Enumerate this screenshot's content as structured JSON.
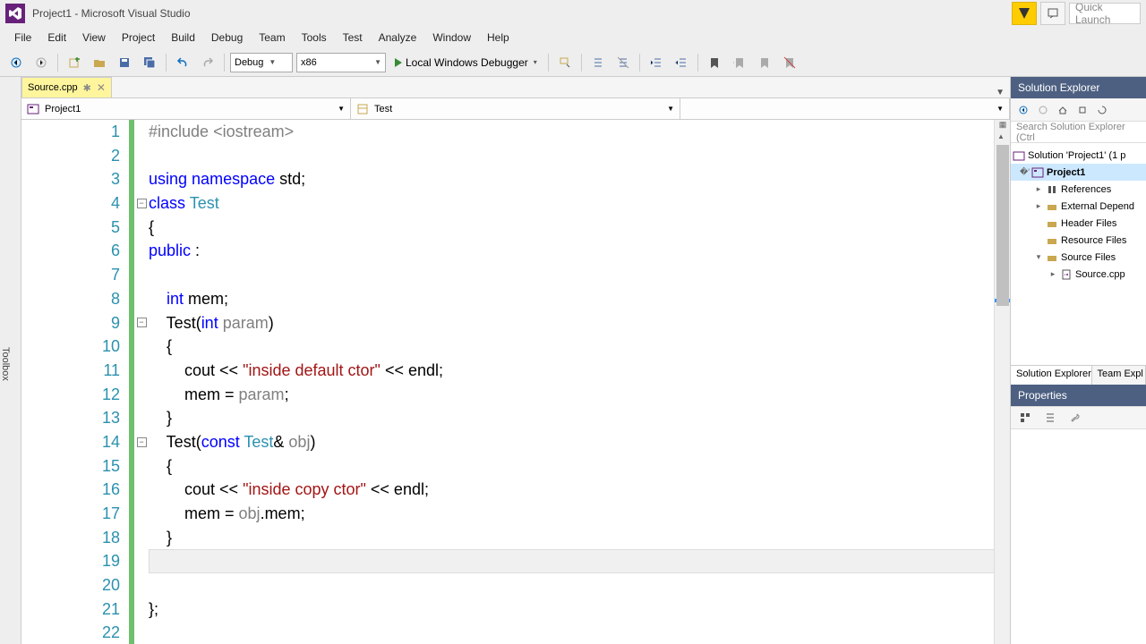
{
  "title": "Project1 - Microsoft Visual Studio",
  "quick_launch_placeholder": "Quick Launch",
  "menu": [
    "File",
    "Edit",
    "View",
    "Project",
    "Build",
    "Debug",
    "Team",
    "Tools",
    "Test",
    "Analyze",
    "Window",
    "Help"
  ],
  "toolbar": {
    "config": "Debug",
    "platform": "x86",
    "debugger": "Local Windows Debugger"
  },
  "toolbox_label": "Toolbox",
  "tab": {
    "name": "Source.cpp",
    "modified": "✱"
  },
  "context": {
    "project": "Project1",
    "scope": "Test"
  },
  "code": [
    {
      "n": 1,
      "fold": "",
      "segs": [
        [
          "preproc",
          "#include "
        ],
        [
          "preproc",
          "<iostream>"
        ]
      ]
    },
    {
      "n": 2,
      "fold": "",
      "segs": [
        [
          "plain",
          ""
        ]
      ]
    },
    {
      "n": 3,
      "fold": "",
      "segs": [
        [
          "kw",
          "using "
        ],
        [
          "kw",
          "namespace "
        ],
        [
          "plain",
          "std;"
        ]
      ]
    },
    {
      "n": 4,
      "fold": "-",
      "segs": [
        [
          "kw",
          "class "
        ],
        [
          "type",
          "Test"
        ]
      ]
    },
    {
      "n": 5,
      "fold": "",
      "segs": [
        [
          "plain",
          "{"
        ]
      ]
    },
    {
      "n": 6,
      "fold": "",
      "segs": [
        [
          "kw",
          "public "
        ],
        [
          "plain",
          ":"
        ]
      ]
    },
    {
      "n": 7,
      "fold": "",
      "segs": [
        [
          "plain",
          ""
        ]
      ]
    },
    {
      "n": 8,
      "fold": "",
      "segs": [
        [
          "plain",
          "    "
        ],
        [
          "kw",
          "int "
        ],
        [
          "plain",
          "mem;"
        ]
      ]
    },
    {
      "n": 9,
      "fold": "-",
      "segs": [
        [
          "plain",
          "    Test("
        ],
        [
          "kw",
          "int "
        ],
        [
          "param",
          "param"
        ],
        [
          "plain",
          ")"
        ]
      ]
    },
    {
      "n": 10,
      "fold": "",
      "segs": [
        [
          "plain",
          "    {"
        ]
      ]
    },
    {
      "n": 11,
      "fold": "",
      "segs": [
        [
          "plain",
          "        cout << "
        ],
        [
          "str",
          "\"inside default ctor\""
        ],
        [
          "plain",
          " << endl;"
        ]
      ]
    },
    {
      "n": 12,
      "fold": "",
      "segs": [
        [
          "plain",
          "        mem = "
        ],
        [
          "param",
          "param"
        ],
        [
          "plain",
          ";"
        ]
      ]
    },
    {
      "n": 13,
      "fold": "",
      "segs": [
        [
          "plain",
          "    }"
        ]
      ]
    },
    {
      "n": 14,
      "fold": "-",
      "segs": [
        [
          "plain",
          "    Test("
        ],
        [
          "kw",
          "const "
        ],
        [
          "type",
          "Test"
        ],
        [
          "plain",
          "& "
        ],
        [
          "param",
          "obj"
        ],
        [
          "plain",
          ")"
        ]
      ]
    },
    {
      "n": 15,
      "fold": "",
      "segs": [
        [
          "plain",
          "    {"
        ]
      ]
    },
    {
      "n": 16,
      "fold": "",
      "segs": [
        [
          "plain",
          "        cout << "
        ],
        [
          "str",
          "\"inside copy ctor\""
        ],
        [
          "plain",
          " << endl;"
        ]
      ]
    },
    {
      "n": 17,
      "fold": "",
      "segs": [
        [
          "plain",
          "        mem = "
        ],
        [
          "param",
          "obj"
        ],
        [
          "plain",
          ".mem;"
        ]
      ]
    },
    {
      "n": 18,
      "fold": "",
      "segs": [
        [
          "plain",
          "    }"
        ]
      ]
    },
    {
      "n": 19,
      "fold": "",
      "current": true,
      "segs": [
        [
          "plain",
          ""
        ]
      ]
    },
    {
      "n": 20,
      "fold": "",
      "segs": [
        [
          "plain",
          ""
        ]
      ]
    },
    {
      "n": 21,
      "fold": "",
      "segs": [
        [
          "plain",
          "};"
        ]
      ]
    },
    {
      "n": 22,
      "fold": "",
      "segs": [
        [
          "plain",
          ""
        ]
      ]
    }
  ],
  "solution_explorer": {
    "title": "Solution Explorer",
    "search_placeholder": "Search Solution Explorer (Ctrl",
    "tree": {
      "solution": "Solution 'Project1' (1 p",
      "project": "Project1",
      "refs": "References",
      "ext": "External Depend",
      "header": "Header Files",
      "resource": "Resource Files",
      "source": "Source Files",
      "file": "Source.cpp"
    },
    "tabs": [
      "Solution Explorer",
      "Team Expl"
    ]
  },
  "properties": {
    "title": "Properties"
  }
}
